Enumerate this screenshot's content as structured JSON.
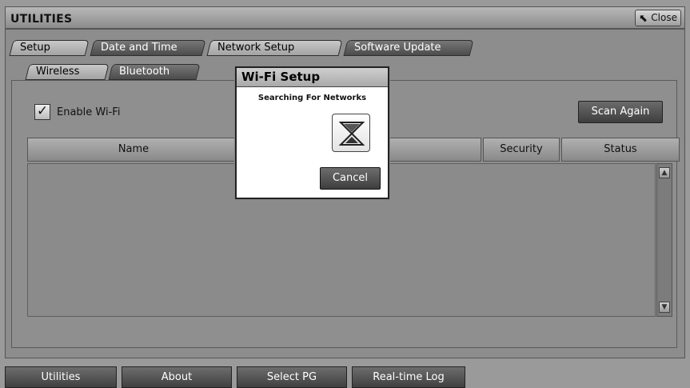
{
  "window": {
    "title": "UTILITIES",
    "close_label": "Close"
  },
  "tabs": [
    {
      "label": "Setup",
      "active": true
    },
    {
      "label": "Date and Time",
      "active": false
    },
    {
      "label": "Network Setup",
      "active": true
    },
    {
      "label": "Software Update",
      "active": false
    }
  ],
  "subtabs": [
    {
      "label": "Wireless",
      "active": true
    },
    {
      "label": "Bluetooth",
      "active": false
    }
  ],
  "wifi": {
    "enable_label": "Enable Wi-Fi",
    "enabled": true,
    "scan_again_label": "Scan Again"
  },
  "table": {
    "columns": [
      "Name",
      "",
      "Security",
      "Status"
    ]
  },
  "modal": {
    "title": "Wi-Fi Setup",
    "message": "Searching For Networks",
    "cancel_label": "Cancel"
  },
  "bottom_nav": [
    "Utilities",
    "About",
    "Select PG",
    "Real-time Log"
  ],
  "colors": {
    "background": "#8f8f8f",
    "tab_dark": "#4c4c4c",
    "modal_bg": "#ffffff"
  }
}
